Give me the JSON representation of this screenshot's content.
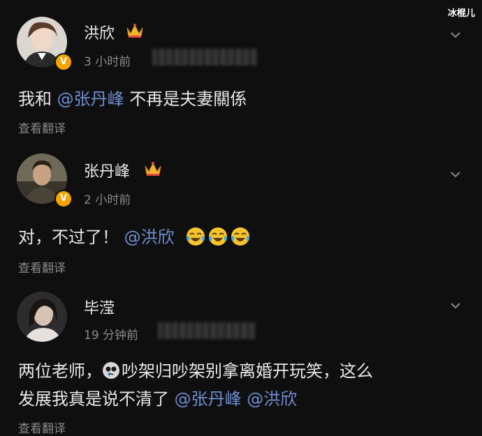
{
  "watermark": "冰棍儿",
  "comments": [
    {
      "author": "洪欣",
      "time": "3 小时前",
      "text_before": "我和 ",
      "mention": "@张丹峰",
      "text_after": " 不再是夫妻關係",
      "translate": "查看翻译"
    },
    {
      "author": "张丹峰",
      "time": "2 小时前",
      "text_before": "对，不过了！",
      "mention": "@洪欣",
      "translate": "查看翻译"
    },
    {
      "author": "毕滢",
      "time": "19 分钟前",
      "line1_before": "两位老师，",
      "line1_after": "吵架归吵架别拿离婚开玩笑，这么",
      "line2_before": "发展我真是说不清了 ",
      "mention1": "@张丹峰",
      "mention2": "@洪欣",
      "translate": "查看翻译"
    }
  ],
  "icons": {
    "verified": "v-badge-icon",
    "crown": "crown-icon",
    "chevron": "chevron-down-icon",
    "laugh_cry": "laugh-cry-emoji-icon",
    "crying": "crying-emoji-icon"
  },
  "colors": {
    "background": "#0f0f10",
    "mention": "#6e8fd1",
    "muted": "#8a8a8a",
    "verified": "#f5a500"
  }
}
